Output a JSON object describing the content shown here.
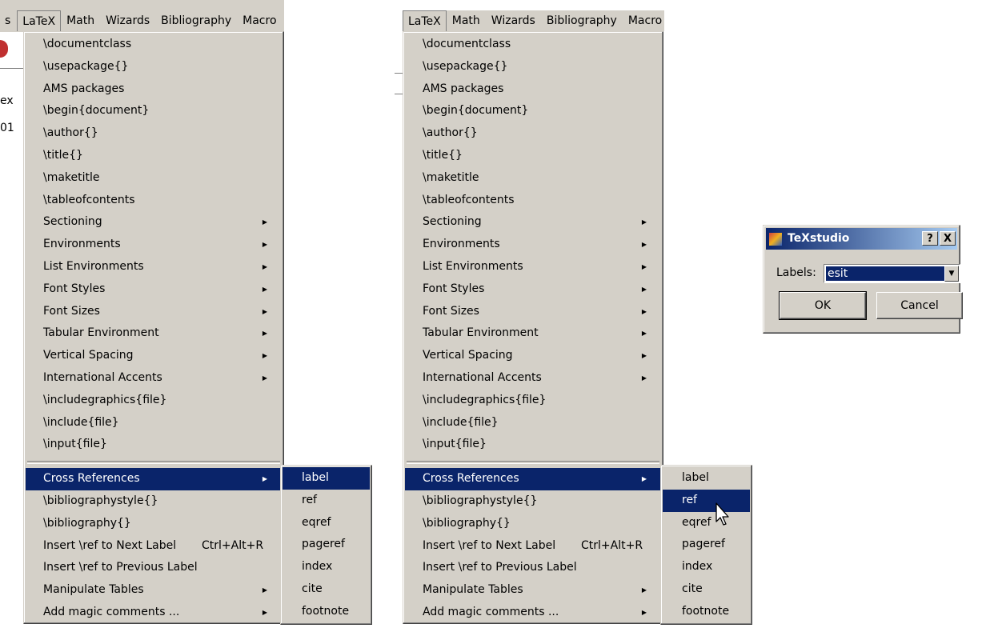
{
  "background": {
    "left_menu_partial": "s",
    "frag_tex": "ex",
    "frag_num": "01"
  },
  "menubar": {
    "items": [
      "LaTeX",
      "Math",
      "Wizards",
      "Bibliography",
      "Macro"
    ]
  },
  "latex_menu": {
    "items": [
      {
        "label": "\\documentclass"
      },
      {
        "label": "\\usepackage{}"
      },
      {
        "label": "AMS packages"
      },
      {
        "label": "\\begin{document}"
      },
      {
        "label": "\\author{}"
      },
      {
        "label": "\\title{}"
      },
      {
        "label": "\\maketitle"
      },
      {
        "label": "\\tableofcontents"
      },
      {
        "label": "Sectioning",
        "submenu": true
      },
      {
        "label": "Environments",
        "submenu": true
      },
      {
        "label": "List Environments",
        "submenu": true
      },
      {
        "label": "Font Styles",
        "submenu": true
      },
      {
        "label": "Font Sizes",
        "submenu": true
      },
      {
        "label": "Tabular Environment",
        "submenu": true
      },
      {
        "label": "Vertical Spacing",
        "submenu": true
      },
      {
        "label": "International Accents",
        "submenu": true
      },
      {
        "label": "\\includegraphics{file}"
      },
      {
        "label": "\\include{file}"
      },
      {
        "label": "\\input{file}"
      }
    ],
    "items2": [
      {
        "label": "Cross References",
        "submenu": true
      },
      {
        "label": "\\bibliographystyle{}"
      },
      {
        "label": "\\bibliography{}"
      },
      {
        "label": "Insert \\ref to Next Label",
        "shortcut": "Ctrl+Alt+R"
      },
      {
        "label": "Insert \\ref to Previous Label"
      },
      {
        "label": "Manipulate Tables",
        "submenu": true
      },
      {
        "label": "Add magic comments ...",
        "submenu": true
      }
    ]
  },
  "crossref_submenu": {
    "items": [
      "label",
      "ref",
      "eqref",
      "pageref",
      "index",
      "cite",
      "footnote"
    ]
  },
  "left_panel": {
    "selected_submenu_item": "label"
  },
  "right_panel": {
    "selected_submenu_item": "ref"
  },
  "dialog": {
    "title": "TeXstudio",
    "help_glyph": "?",
    "close_glyph": "X",
    "labels_caption": "Labels:",
    "labels_value": "esit",
    "ok_label": "OK",
    "cancel_label": "Cancel",
    "dropdown_glyph": "▼"
  },
  "colors": {
    "menu_bg": "#d4d0c8",
    "highlight": "#0a246a",
    "title_gradient_start": "#0a246a",
    "title_gradient_end": "#a6caf0"
  }
}
